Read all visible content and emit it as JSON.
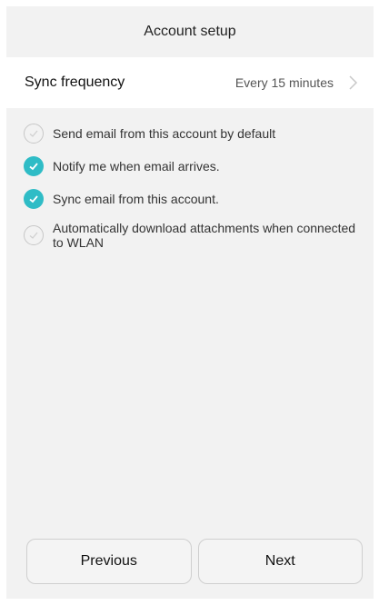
{
  "header": {
    "title": "Account setup"
  },
  "sync": {
    "label": "Sync frequency",
    "value": "Every 15 minutes",
    "icon": "chevron-right-icon"
  },
  "options": [
    {
      "label": "Send email from this account by default",
      "checked": false
    },
    {
      "label": "Notify me when email arrives.",
      "checked": true
    },
    {
      "label": "Sync email from this account.",
      "checked": true
    },
    {
      "label": "Automatically download attachments when connected to WLAN",
      "checked": false
    }
  ],
  "footer": {
    "previous_label": "Previous",
    "next_label": "Next"
  },
  "colors": {
    "accent": "#2fbcc6",
    "background": "#f2f2f2"
  }
}
